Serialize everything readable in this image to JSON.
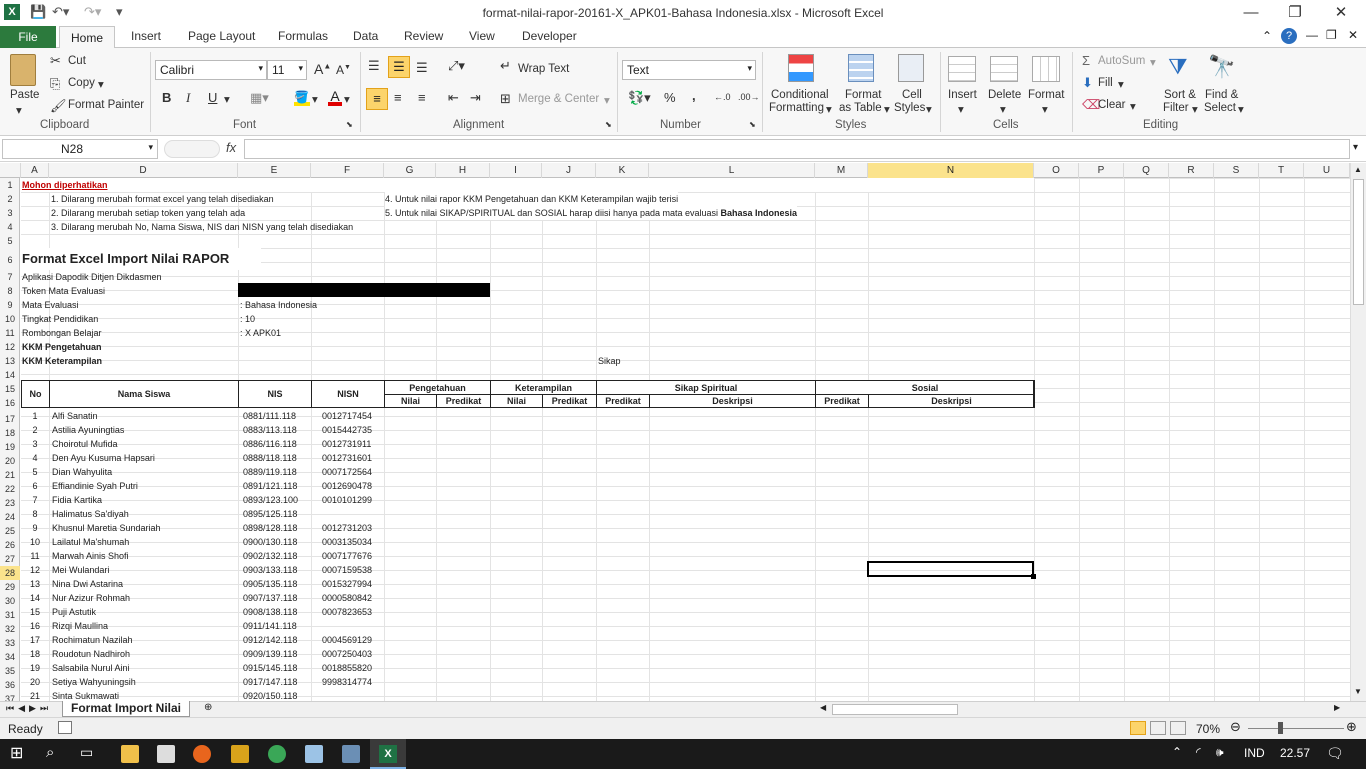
{
  "window": {
    "title": "format-nilai-rapor-20161-X_APK01-Bahasa Indonesia.xlsx - Microsoft Excel",
    "minimize": "—",
    "restore": "❐",
    "close": "✕"
  },
  "tabs": [
    "File",
    "Home",
    "Insert",
    "Page Layout",
    "Formulas",
    "Data",
    "Review",
    "View",
    "Developer"
  ],
  "ribbon": {
    "clipboard": {
      "paste": "Paste",
      "cut": "Cut",
      "copy": "Copy",
      "format_painter": "Format Painter",
      "label": "Clipboard"
    },
    "font": {
      "name": "Calibri",
      "size": "11",
      "label": "Font",
      "bold": "B",
      "italic": "I",
      "underline": "U"
    },
    "alignment": {
      "wrap_text": "Wrap Text",
      "merge_center": "Merge & Center",
      "label": "Alignment"
    },
    "number": {
      "format": "Text",
      "percent": "%",
      "comma": ",",
      "label": "Number"
    },
    "styles": {
      "conditional": "Conditional",
      "formatting": "Formatting",
      "format_as": "Format",
      "as_table": "as Table",
      "cell": "Cell",
      "cell_styles": "Styles",
      "label": "Styles"
    },
    "cells": {
      "insert": "Insert",
      "delete": "Delete",
      "format": "Format",
      "label": "Cells"
    },
    "editing": {
      "autosum": "AutoSum",
      "fill": "Fill",
      "clear": "Clear",
      "sort1": "Sort &",
      "sort2": "Filter",
      "find1": "Find &",
      "find2": "Select",
      "label": "Editing"
    }
  },
  "formula_bar": {
    "name_box": "N28",
    "fx": "fx",
    "value": ""
  },
  "columns": [
    "A",
    "D",
    "E",
    "F",
    "G",
    "H",
    "I",
    "J",
    "K",
    "L",
    "M",
    "N",
    "O",
    "P",
    "Q",
    "R",
    "S",
    "T",
    "U"
  ],
  "row_numbers": [
    "1",
    "2",
    "3",
    "4",
    "5",
    "6",
    "7",
    "8",
    "9",
    "10",
    "11",
    "12",
    "13",
    "14",
    "15",
    "16",
    "17",
    "18",
    "19",
    "20",
    "21",
    "22",
    "23",
    "24",
    "25",
    "26",
    "27",
    "28",
    "29",
    "30",
    "31",
    "32",
    "33",
    "34",
    "35",
    "36",
    "37"
  ],
  "selected_row": "28",
  "selected_col": "N",
  "sheet": {
    "notice_title": "Mohon diperhatikan",
    "notice_left": [
      "1. Dilarang merubah format excel yang telah disediakan",
      "2. Dilarang merubah setiap token yang telah ada",
      "3. Dilarang merubah No, Nama Siswa, NIS dan NISN yang telah disediakan"
    ],
    "notice_right_4": "4. Untuk nilai rapor KKM Pengetahuan dan KKM Keterampilan wajib terisi",
    "notice_right_5": "5. Untuk nilai SIKAP/SPIRITUAL dan SOSIAL harap diisi hanya pada mata evaluasi",
    "notice_right_5_bold": "Bahasa Indonesia",
    "main_title": "Format Excel Import Nilai RAPOR",
    "subtitle": "Aplikasi Dapodik Ditjen Dikdasmen",
    "info_labels": [
      "Token Mata Evaluasi",
      "Mata Evaluasi",
      "Tingkat Pendidikan",
      "Rombongan Belajar"
    ],
    "info_values": [
      "",
      ": Bahasa Indonesia",
      ": 10",
      ": X APK01"
    ],
    "kkm_pengetahuan": "KKM Pengetahuan",
    "kkm_keterampilan": "KKM Keterampilan",
    "sikap": "Sikap",
    "headers": {
      "no": "No",
      "nama": "Nama Siswa",
      "nis": "NIS",
      "nisn": "NISN",
      "pengetahuan": "Pengetahuan",
      "keterampilan": "Keterampilan",
      "spiritual": "Sikap Spiritual",
      "sosial": "Sosial",
      "nilai": "Nilai",
      "predikat": "Predikat",
      "deskripsi": "Deskripsi"
    },
    "students": [
      {
        "no": "1",
        "nama": "Alfi Sanatin",
        "nis": "0881/111.118",
        "nisn": "0012717454"
      },
      {
        "no": "2",
        "nama": "Astilia Ayuningtias",
        "nis": "0883/113.118",
        "nisn": "0015442735"
      },
      {
        "no": "3",
        "nama": "Choirotul Mufida",
        "nis": "0886/116.118",
        "nisn": "0012731911"
      },
      {
        "no": "4",
        "nama": "Den Ayu Kusuma Hapsari",
        "nis": "0888/118.118",
        "nisn": "0012731601"
      },
      {
        "no": "5",
        "nama": "Dian Wahyulita",
        "nis": "0889/119.118",
        "nisn": "0007172564"
      },
      {
        "no": "6",
        "nama": "Effiandinie Syah Putri",
        "nis": "0891/121.118",
        "nisn": "0012690478"
      },
      {
        "no": "7",
        "nama": "Fidia Kartika",
        "nis": "0893/123.100",
        "nisn": "0010101299"
      },
      {
        "no": "8",
        "nama": "Halimatus Sa'diyah",
        "nis": "0895/125.118",
        "nisn": ""
      },
      {
        "no": "9",
        "nama": "Khusnul Maretia Sundariah",
        "nis": "0898/128.118",
        "nisn": "0012731203"
      },
      {
        "no": "10",
        "nama": "Lailatul Ma'shumah",
        "nis": "0900/130.118",
        "nisn": "0003135034"
      },
      {
        "no": "11",
        "nama": "Marwah Ainis Shofi",
        "nis": "0902/132.118",
        "nisn": "0007177676"
      },
      {
        "no": "12",
        "nama": "Mei Wulandari",
        "nis": "0903/133.118",
        "nisn": "0007159538"
      },
      {
        "no": "13",
        "nama": "Nina Dwi Astarina",
        "nis": "0905/135.118",
        "nisn": "0015327994"
      },
      {
        "no": "14",
        "nama": "Nur Azizur Rohmah",
        "nis": "0907/137.118",
        "nisn": "0000580842"
      },
      {
        "no": "15",
        "nama": "Puji Astutik",
        "nis": "0908/138.118",
        "nisn": "0007823653"
      },
      {
        "no": "16",
        "nama": "Rizqi Maullina",
        "nis": "0911/141.118",
        "nisn": ""
      },
      {
        "no": "17",
        "nama": "Rochimatun Nazilah",
        "nis": "0912/142.118",
        "nisn": "0004569129"
      },
      {
        "no": "18",
        "nama": "Roudotun Nadhiroh",
        "nis": "0909/139.118",
        "nisn": "0007250403"
      },
      {
        "no": "19",
        "nama": "Salsabila Nurul Aini",
        "nis": "0915/145.118",
        "nisn": "0018855820"
      },
      {
        "no": "20",
        "nama": "Setiya Wahyuningsih",
        "nis": "0917/147.118",
        "nisn": "9998314774"
      },
      {
        "no": "21",
        "nama": "Sinta Sukmawati",
        "nis": "0920/150.118",
        "nisn": ""
      }
    ]
  },
  "sheet_tab": "Format Import Nilai",
  "status": {
    "ready": "Ready",
    "zoom": "70%"
  },
  "taskbar": {
    "lang": "IND",
    "time": "22.57"
  },
  "colors": {
    "file_tab": "#2c7a3d",
    "selection": "#fbe38c",
    "notice": "#c00000",
    "taskbar": "#1a1a1a"
  }
}
